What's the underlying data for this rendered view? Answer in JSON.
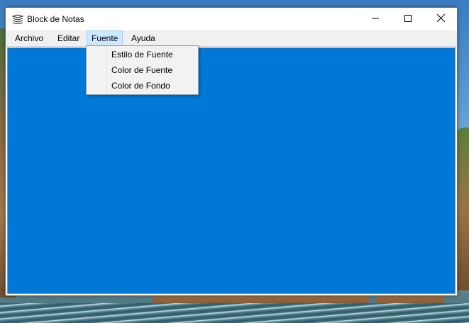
{
  "window": {
    "title": "Block de Notas",
    "icons": {
      "app": "notepad-icon",
      "minimize": "minimize-icon",
      "maximize": "maximize-icon",
      "close": "close-icon"
    }
  },
  "menubar": {
    "items": [
      {
        "label": "Archivo"
      },
      {
        "label": "Editar"
      },
      {
        "label": "Fuente",
        "open": true
      },
      {
        "label": "Ayuda"
      }
    ]
  },
  "dropdown": {
    "items": [
      {
        "label": "Estilo de Fuente"
      },
      {
        "label": "Color de Fuente"
      },
      {
        "label": "Color de Fondo"
      }
    ]
  },
  "editor": {
    "background_color": "#0078d7",
    "text": ""
  },
  "colors": {
    "menu_highlight": "#cce8ff",
    "menu_highlight_border": "#99d1ff"
  }
}
